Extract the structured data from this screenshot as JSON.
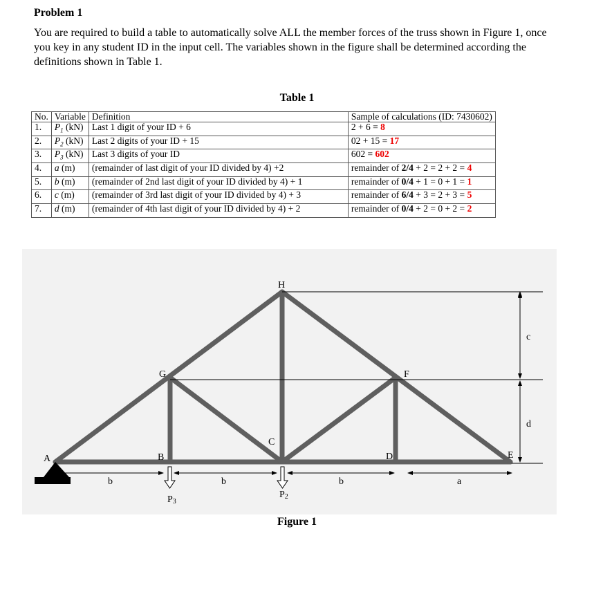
{
  "problem": {
    "title": "Problem 1",
    "description": "You are required to build a table to automatically solve ALL the member forces of the truss shown in Figure 1, once you key in any student ID in the input cell. The variables shown in the figure shall be determined according the definitions shown in Table 1."
  },
  "table": {
    "title": "Table 1",
    "headers": [
      "No.",
      "Variable",
      "Definition",
      "Sample of calculations (ID: 7430602)"
    ],
    "rows": [
      {
        "no": "1.",
        "var": "P",
        "sub": "1",
        "unit": " (kN)",
        "def": "Last 1 digit of your ID + 6",
        "calc": "2 + 6 = ",
        "calc_bold": "",
        "calc_rest": "",
        "result": "8"
      },
      {
        "no": "2.",
        "var": "P",
        "sub": "2",
        "unit": " (kN)",
        "def": "Last 2 digits of your ID + 15",
        "calc": "02 + 15 = ",
        "calc_bold": "",
        "calc_rest": "",
        "result": "17"
      },
      {
        "no": "3.",
        "var": "P",
        "sub": "3",
        "unit": " (kN)",
        "def": "Last 3 digits of your ID",
        "calc": "602 = ",
        "calc_bold": "",
        "calc_rest": "",
        "result": "602"
      },
      {
        "no": "4.",
        "var": "a",
        "sub": "",
        "unit": " (m)",
        "def": "(remainder of last digit of your ID divided by 4) +2",
        "calc": "remainder of ",
        "calc_bold": "2/4",
        "calc_rest": " + 2 = 2 + 2 = ",
        "result": "4"
      },
      {
        "no": "5.",
        "var": "b",
        "sub": "",
        "unit": " (m)",
        "def": "(remainder of 2nd last digit of your ID divided by 4) + 1",
        "calc": "remainder of ",
        "calc_bold": "0/4",
        "calc_rest": " + 1 = 0 + 1 = ",
        "result": "1"
      },
      {
        "no": "6.",
        "var": "c",
        "sub": "",
        "unit": " (m)",
        "def": "(remainder of 3rd last digit of your ID divided by 4) + 3",
        "calc": "remainder of ",
        "calc_bold": "6/4",
        "calc_rest": " + 3 = 2 + 3 = ",
        "result": "5"
      },
      {
        "no": "7.",
        "var": "d",
        "sub": "",
        "unit": " (m)",
        "def": "(remainder of 4th last digit of your ID divided by 4) + 2",
        "calc": "remainder of ",
        "calc_bold": "0/4",
        "calc_rest": " + 2 = 0 + 2 = ",
        "result": "2"
      }
    ]
  },
  "figure": {
    "caption": "Figure 1",
    "nodes": {
      "A": "A",
      "B": "B",
      "C": "C",
      "D": "D",
      "E": "E",
      "F": "F",
      "G": "G",
      "H": "H"
    },
    "dims": {
      "b1": "b",
      "b2": "b",
      "b3": "b",
      "a": "a",
      "c": "c",
      "d": "d"
    },
    "loads": {
      "P3": "P",
      "P3sub": "3",
      "P2": "P",
      "P2sub": "2"
    },
    "colors": {
      "member": "#5f5f5f",
      "background": "#f2f2f2",
      "highlight": "#ee0000"
    }
  }
}
